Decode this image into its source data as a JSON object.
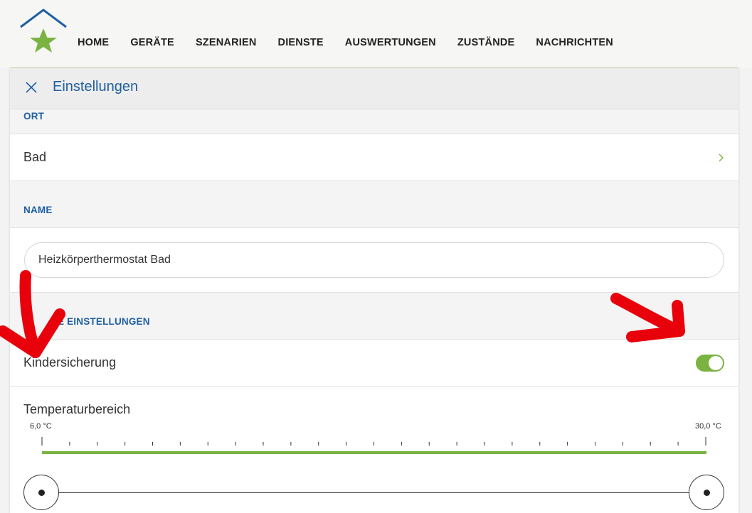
{
  "nav": [
    "HOME",
    "GERÄTE",
    "SZENARIEN",
    "DIENSTE",
    "AUSWERTUNGEN",
    "ZUSTÄNDE",
    "NACHRICHTEN"
  ],
  "panel": {
    "title": "Einstellungen"
  },
  "ort": {
    "label": "ORT",
    "value": "Bad"
  },
  "name": {
    "label": "NAME",
    "value": "Heizkörperthermostat Bad"
  },
  "weitere": {
    "label_visible": "RE EINSTELLUNGEN",
    "child_lock_label": "Kindersicherung",
    "child_lock_on": true
  },
  "temperature": {
    "label": "Temperaturbereich",
    "min_label": "6,0 °C",
    "max_label": "30,0 °C",
    "min": 6.0,
    "max": 30.0,
    "low_value": 6.0,
    "high_value": 30.0
  },
  "colors": {
    "accent_green": "#7ab342",
    "accent_blue": "#1f5fa3",
    "annotation_red": "#e8000b"
  },
  "icons": [
    "house-star-logo-icon",
    "close-icon",
    "chevron-right-icon"
  ]
}
